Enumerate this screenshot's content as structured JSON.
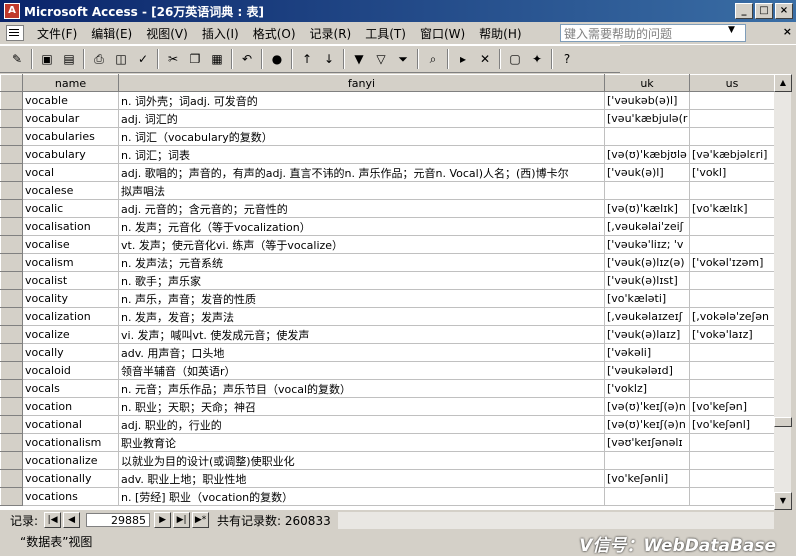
{
  "window": {
    "title": "Microsoft Access - [26万英语词典 : 表]"
  },
  "menu": [
    "文件(F)",
    "编辑(E)",
    "视图(V)",
    "插入(I)",
    "格式(O)",
    "记录(R)",
    "工具(T)",
    "窗口(W)",
    "帮助(H)"
  ],
  "help_placeholder": "键入需要帮助的问题",
  "columns": [
    "name",
    "fanyi",
    "uk",
    "us"
  ],
  "rows": [
    [
      "vocable",
      "n. 词外壳；词adj. 可发音的",
      "['vəukəb(ə)l]",
      ""
    ],
    [
      "vocabular",
      "adj. 词汇的",
      "[vəu'kæbjulə(r",
      ""
    ],
    [
      "vocabularies",
      "n. 词汇（vocabulary的复数）",
      "",
      ""
    ],
    [
      "vocabulary",
      "n. 词汇；词表",
      "[və(ʊ)'kæbjʊlə",
      "[və'kæbjəlɛri]"
    ],
    [
      "vocal",
      "adj. 歌唱的；声音的，有声的adj. 直言不讳的n. 声乐作品；元音n. Vocal)人名；(西)博卡尔",
      "['vəuk(ə)l]",
      "['vokl]"
    ],
    [
      "vocalese",
      "拟声唱法",
      "",
      ""
    ],
    [
      "vocalic",
      "adj. 元音的；含元音的；元音性的",
      "[və(ʊ)'kælɪk]",
      "[vo'kælɪk]"
    ],
    [
      "vocalisation",
      "n. 发声；元音化（等于vocalization）",
      "[,vəukəlai'zeiʃ",
      ""
    ],
    [
      "vocalise",
      "vt. 发声；使元音化vi. 练声（等于vocalize）",
      "['vəukə'liɪz; 'v",
      ""
    ],
    [
      "vocalism",
      "n. 发声法；元音系统",
      "['vəuk(ə)lɪz(ə)",
      "['vokəl'ɪzəm]"
    ],
    [
      "vocalist",
      "n. 歌手；声乐家",
      "['vəuk(ə)lɪst]",
      ""
    ],
    [
      "vocality",
      "n. 声乐，声音；发音的性质",
      "[vo'kæləti]",
      ""
    ],
    [
      "vocalization",
      "n. 发声，发音；发声法",
      "[,vəukəlaɪzeɪʃ",
      "[,vokələ'zeʃən"
    ],
    [
      "vocalize",
      "vi. 发声；喊叫vt. 使发成元音；使发声",
      "['vəuk(ə)laɪz]",
      "['vokə'laɪz]"
    ],
    [
      "vocally",
      "adv. 用声音；口头地",
      "['vəkəli]",
      ""
    ],
    [
      "vocaloid",
      "领音半辅音（如英语r）",
      "['vəukələɪd]",
      ""
    ],
    [
      "vocals",
      "n. 元音；声乐作品；声乐节目（vocal的复数）",
      "['voklz]",
      ""
    ],
    [
      "vocation",
      "n. 职业；天职；天命；神召",
      "[və(ʊ)'keɪʃ(ə)n",
      "[vo'keʃən]"
    ],
    [
      "vocational",
      "adj. 职业的，行业的",
      "[və(ʊ)'keɪʃ(ə)n",
      "[vo'keʃənl]"
    ],
    [
      "vocationalism",
      "职业教育论",
      "[vəʊ'keɪʃənəlɪ",
      ""
    ],
    [
      "vocationalize",
      "以就业为目的设计(或调整)使职业化",
      "",
      ""
    ],
    [
      "vocationally",
      "adv. 职业上地；职业性地",
      "[vo'keʃənli]",
      ""
    ],
    [
      "vocations",
      "n. [劳经] 职业（vocation的复数）",
      "",
      ""
    ]
  ],
  "navigation": {
    "label": "记录:",
    "current": "29885",
    "total_label": "共有记录数: 260833"
  },
  "status": "“数据表”视图",
  "watermark": "V信号：WebDataBase"
}
